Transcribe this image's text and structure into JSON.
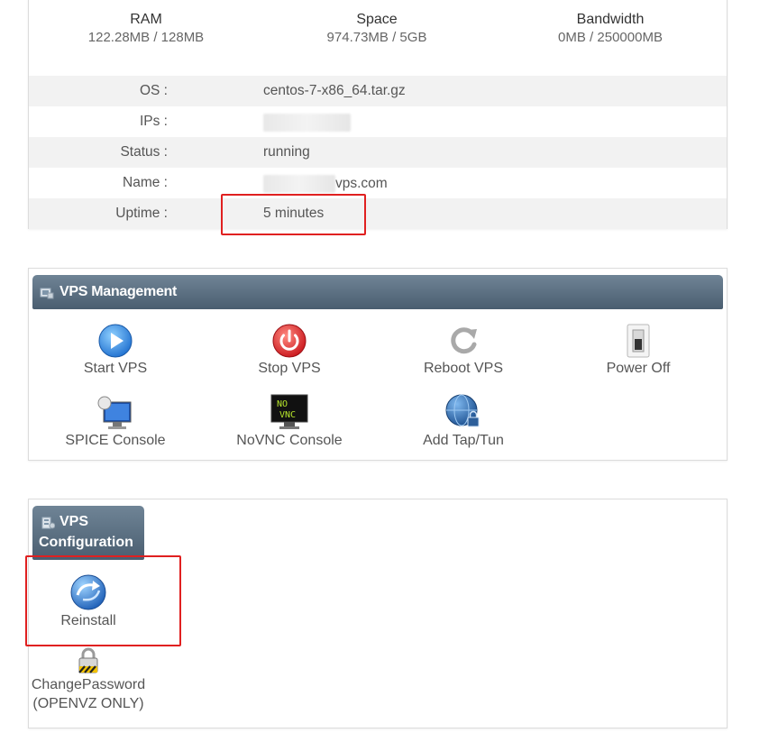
{
  "usage": [
    {
      "label": "RAM",
      "value": "122.28MB / 128MB"
    },
    {
      "label": "Space",
      "value": "974.73MB / 5GB"
    },
    {
      "label": "Bandwidth",
      "value": "0MB / 250000MB"
    }
  ],
  "info": {
    "os_label": "OS :",
    "os_value": "centos-7-x86_64.tar.gz",
    "ips_label": "IPs :",
    "status_label": "Status :",
    "status_value": "running",
    "name_label": "Name :",
    "name_value": "vps.com",
    "uptime_label": "Uptime :",
    "uptime_value": "5 minutes"
  },
  "management": {
    "title": "VPS Management",
    "actions": [
      {
        "label": "Start VPS",
        "icon": "play-icon"
      },
      {
        "label": "Stop VPS",
        "icon": "power-icon"
      },
      {
        "label": "Reboot VPS",
        "icon": "reboot-icon"
      },
      {
        "label": "Power Off",
        "icon": "switch-icon"
      },
      {
        "label": "SPICE Console",
        "icon": "monitor-icon"
      },
      {
        "label": "NoVNC Console",
        "icon": "novnc-icon"
      },
      {
        "label": "Add Tap/Tun",
        "icon": "globe-lock-icon"
      }
    ],
    "novnc_glyph_1": "NO",
    "novnc_glyph_2": "VNC"
  },
  "configuration": {
    "title_line1": "VPS",
    "title_line2": "Configuration",
    "reinstall_label": "Reinstall",
    "password_label_1": "ChangePassword",
    "password_label_2": "(OPENVZ ONLY)"
  },
  "colors": {
    "header_top": "#6f8496",
    "header_bottom": "#4a5e70",
    "highlight": "#e02020",
    "alt_row": "#f2f2f2"
  }
}
